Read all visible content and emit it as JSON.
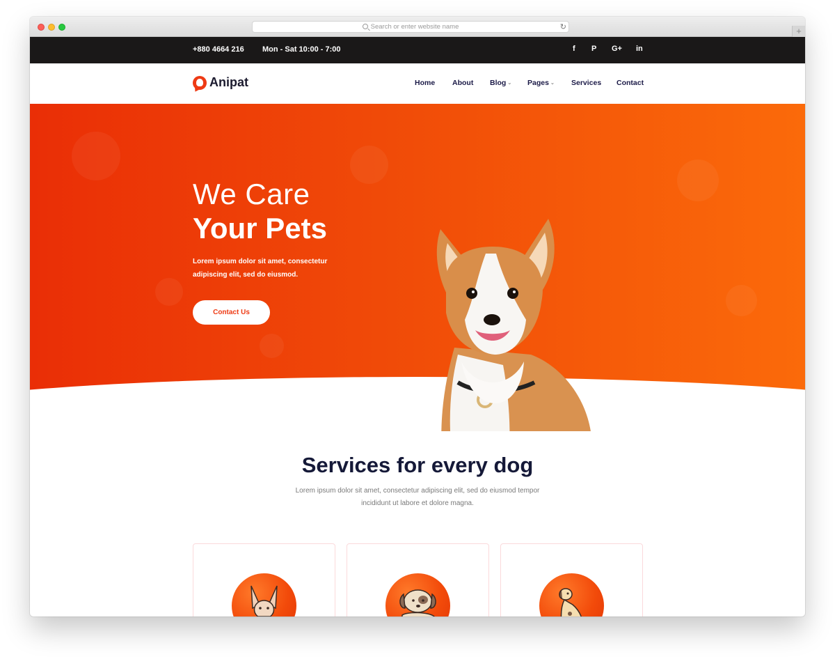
{
  "browser": {
    "address_placeholder": "Search or enter website name",
    "reload_icon": "reload-icon",
    "new_tab_label": "+"
  },
  "topbar": {
    "phone": "+880 4664 216",
    "hours": "Mon - Sat 10:00 - 7:00",
    "social": [
      {
        "icon": "facebook-icon",
        "label": "f"
      },
      {
        "icon": "pinterest-icon",
        "label": "P"
      },
      {
        "icon": "google-plus-icon",
        "label": "G+"
      },
      {
        "icon": "linkedin-icon",
        "label": "in"
      }
    ]
  },
  "nav": {
    "logo_text": "Anipat",
    "items": [
      "Home",
      "About",
      "Blog",
      "Pages",
      "Services",
      "Contact"
    ]
  },
  "hero": {
    "title_line_1": "We Care",
    "title_line_2": "Your Pets",
    "text": "Lorem ipsum dolor sit amet, consectetur adipiscing elit, sed do eiusmod.",
    "button_label": "Contact Us",
    "accent_color": "#ee3a14"
  },
  "services": {
    "title": "Services for every dog",
    "subtitle": "Lorem ipsum dolor sit amet, consectetur adipiscing elit, sed do eiusmod tempor incididunt ut labore et dolore magna.",
    "cards": [
      {
        "icon": "chihuahua-dog-icon"
      },
      {
        "icon": "puppy-dog-icon"
      },
      {
        "icon": "sitting-dalmatian-dog-icon"
      }
    ]
  }
}
